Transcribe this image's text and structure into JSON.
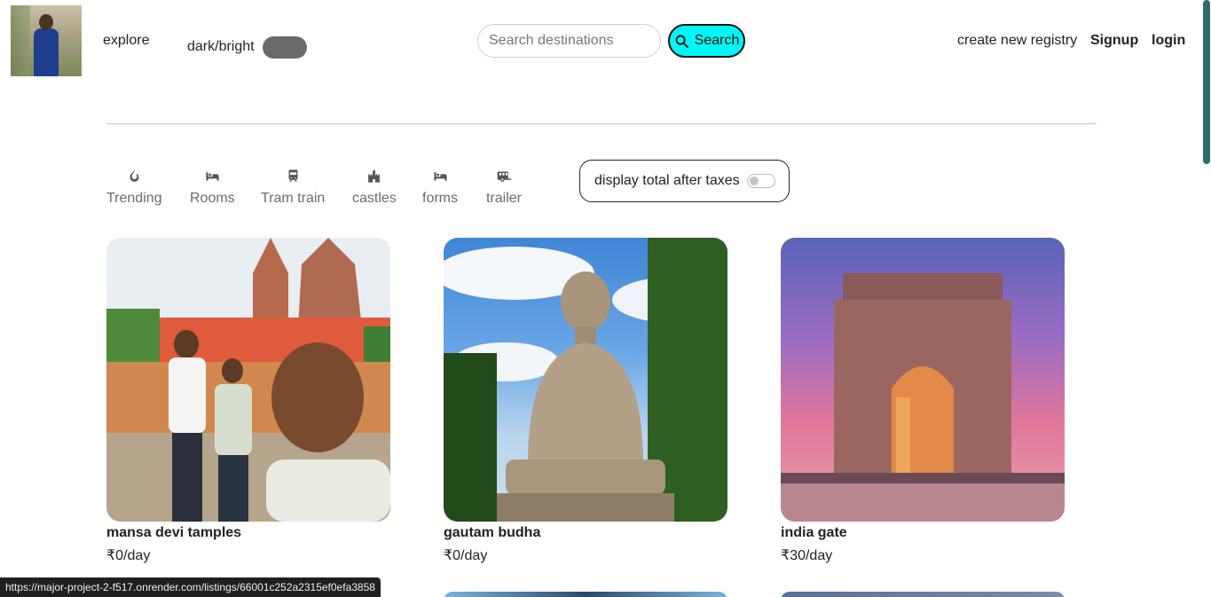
{
  "navbar": {
    "explore": "explore",
    "theme_label": "dark/bright",
    "search_placeholder": "Search destinations",
    "search_button": "Search",
    "create": "create new registry",
    "signup": "Signup",
    "login": "login"
  },
  "filters": {
    "items": [
      {
        "label": "Trending",
        "icon": "fire-icon"
      },
      {
        "label": "Rooms",
        "icon": "bed-icon"
      },
      {
        "label": "Tram train",
        "icon": "train-icon"
      },
      {
        "label": "castles",
        "icon": "castle-icon"
      },
      {
        "label": "forms",
        "icon": "bed-icon"
      },
      {
        "label": "trailer",
        "icon": "trailer-icon"
      }
    ],
    "tax_label": "display total after taxes"
  },
  "listings": [
    {
      "title": "mansa devi tamples",
      "price": "₹0/day"
    },
    {
      "title": "gautam budha",
      "price": "₹0/day"
    },
    {
      "title": "india gate",
      "price": "₹30/day"
    }
  ],
  "status_url": "https://major-project-2-f517.onrender.com/listings/66001c252a2315ef0efa3858",
  "colors": {
    "search_button": "#00f6f6",
    "toggle": "#6a6a6a",
    "scroll_thumb": "#2d6e64"
  }
}
